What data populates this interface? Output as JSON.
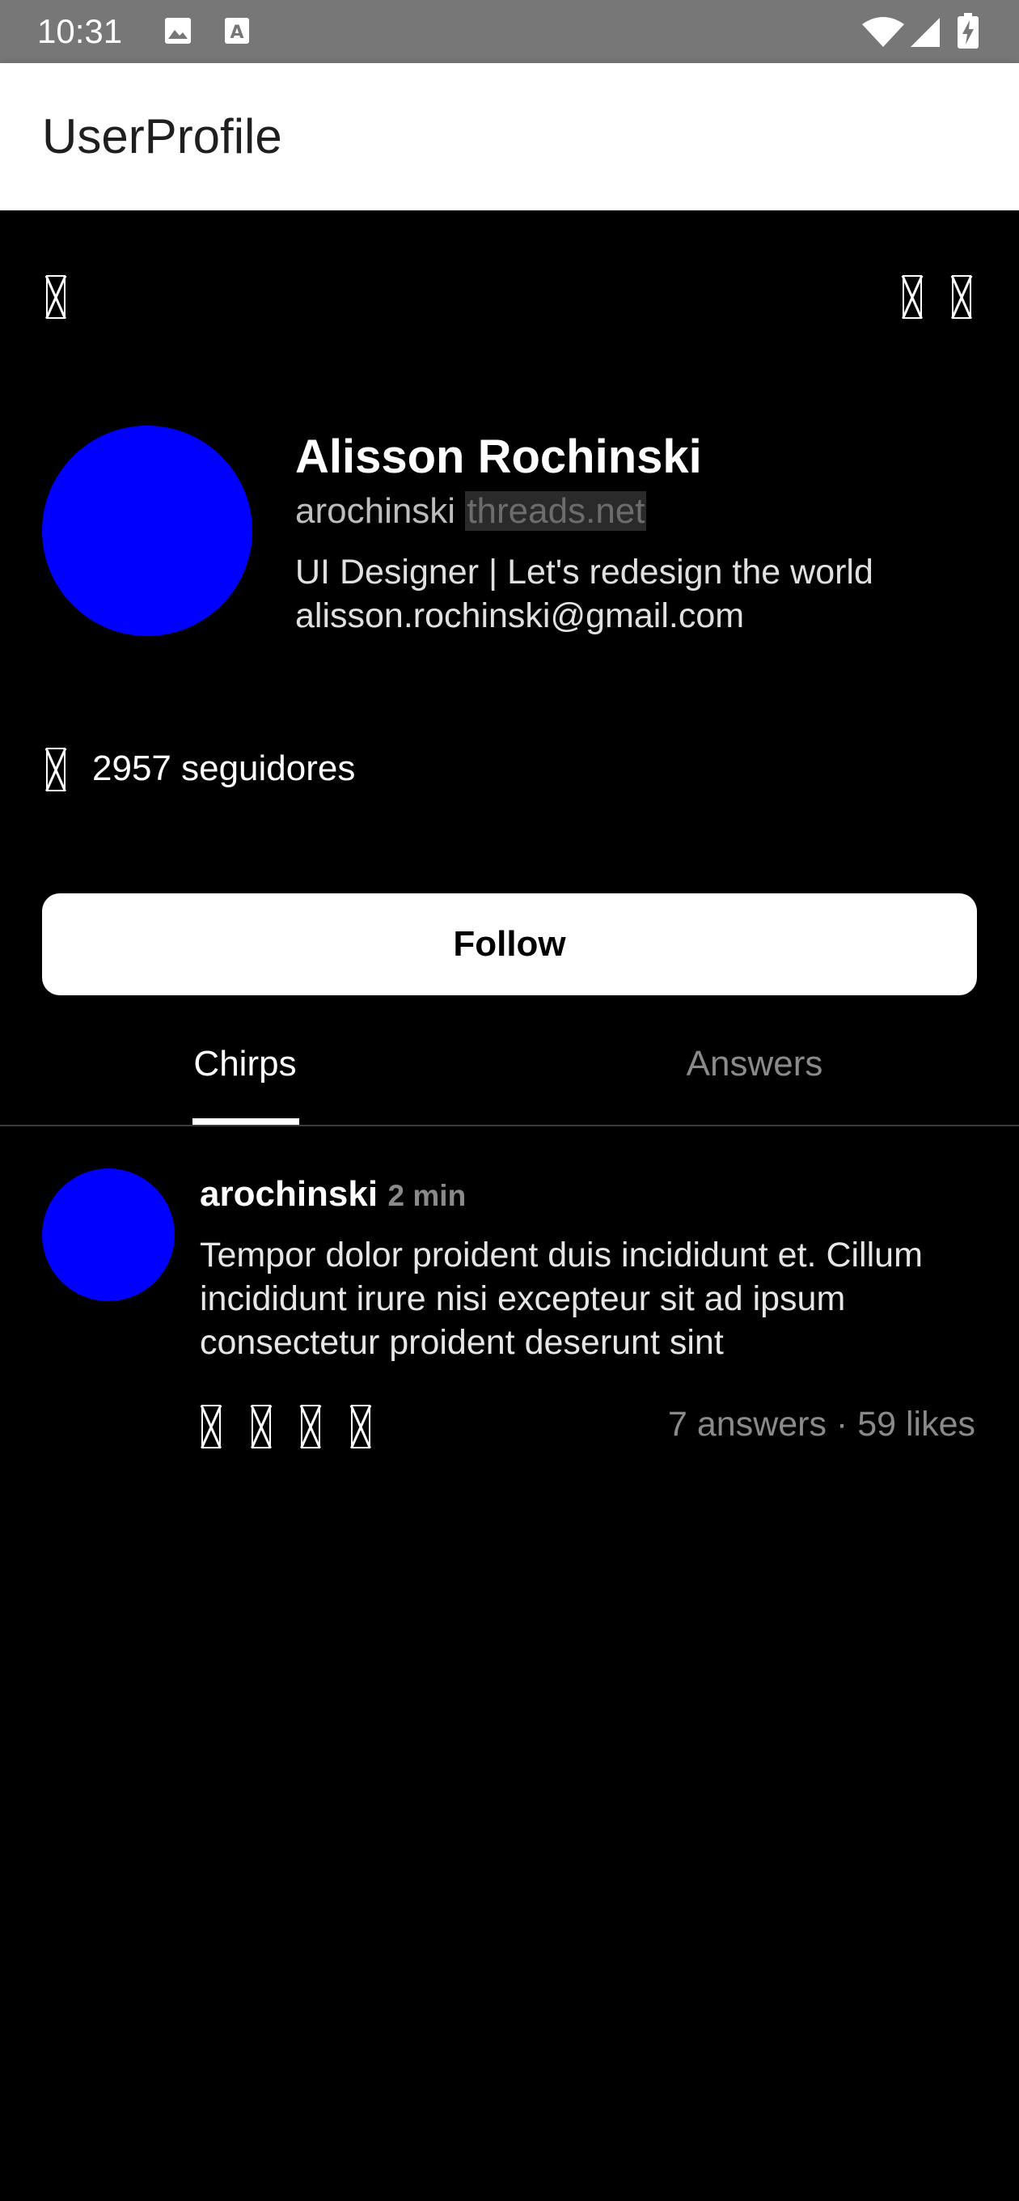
{
  "status_bar": {
    "time": "10:31",
    "icons": [
      "image-icon",
      "text-app-icon",
      "wifi-icon",
      "signal-icon",
      "battery-charging-icon"
    ]
  },
  "app_bar": {
    "title": "UserProfile"
  },
  "top_actions": [
    "back-icon",
    "share-icon",
    "more-icon"
  ],
  "profile": {
    "name": "Alisson Rochinski",
    "username": "arochinski",
    "domain": "threads.net",
    "bio": "UI Designer | Let's redesign the world\nalisson.rochinski@gmail.com",
    "avatar_color": "#0000ff",
    "followers": "2957 seguidores"
  },
  "follow_button": {
    "label": "Follow"
  },
  "tabs": [
    {
      "label": "Chirps",
      "active": true
    },
    {
      "label": "Answers",
      "active": false
    }
  ],
  "posts": [
    {
      "author": "arochinski",
      "time": "2 min",
      "body": "Tempor dolor proident duis incididunt et. Cillum incididunt irure nisi excepteur sit ad ipsum consectetur proident deserunt sint",
      "stats": "7 answers · 59 likes",
      "actions": [
        "like-icon",
        "reply-icon",
        "repost-icon",
        "share-icon"
      ]
    }
  ],
  "colors": {
    "background": "#000000",
    "avatar": "#0000ff",
    "status_bar": "#777777",
    "muted_text": "#8a8a8a"
  }
}
